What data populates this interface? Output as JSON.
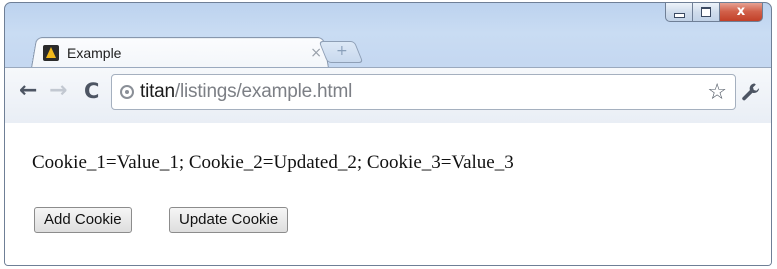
{
  "window": {
    "minimize_icon": "minimize-icon",
    "maximize_icon": "maximize-icon",
    "close_icon": "close-icon",
    "close_glyph": "x"
  },
  "tab": {
    "title": "Example",
    "close_glyph": "×",
    "favicon": "favicon-icon"
  },
  "new_tab": {
    "glyph": "+"
  },
  "toolbar": {
    "back_glyph": "←",
    "forward_glyph": "→",
    "reload_glyph": "C",
    "star_glyph": "☆",
    "wrench_icon": "wrench-icon"
  },
  "address": {
    "host": "titan",
    "path": "/listings/example.html"
  },
  "content": {
    "cookies_text": "Cookie_1=Value_1; Cookie_2=Updated_2; Cookie_3=Value_3",
    "add_button": "Add Cookie",
    "update_button": "Update Cookie"
  },
  "colors": {
    "frame": "#c5d8f1",
    "close_button": "#c94a33"
  }
}
